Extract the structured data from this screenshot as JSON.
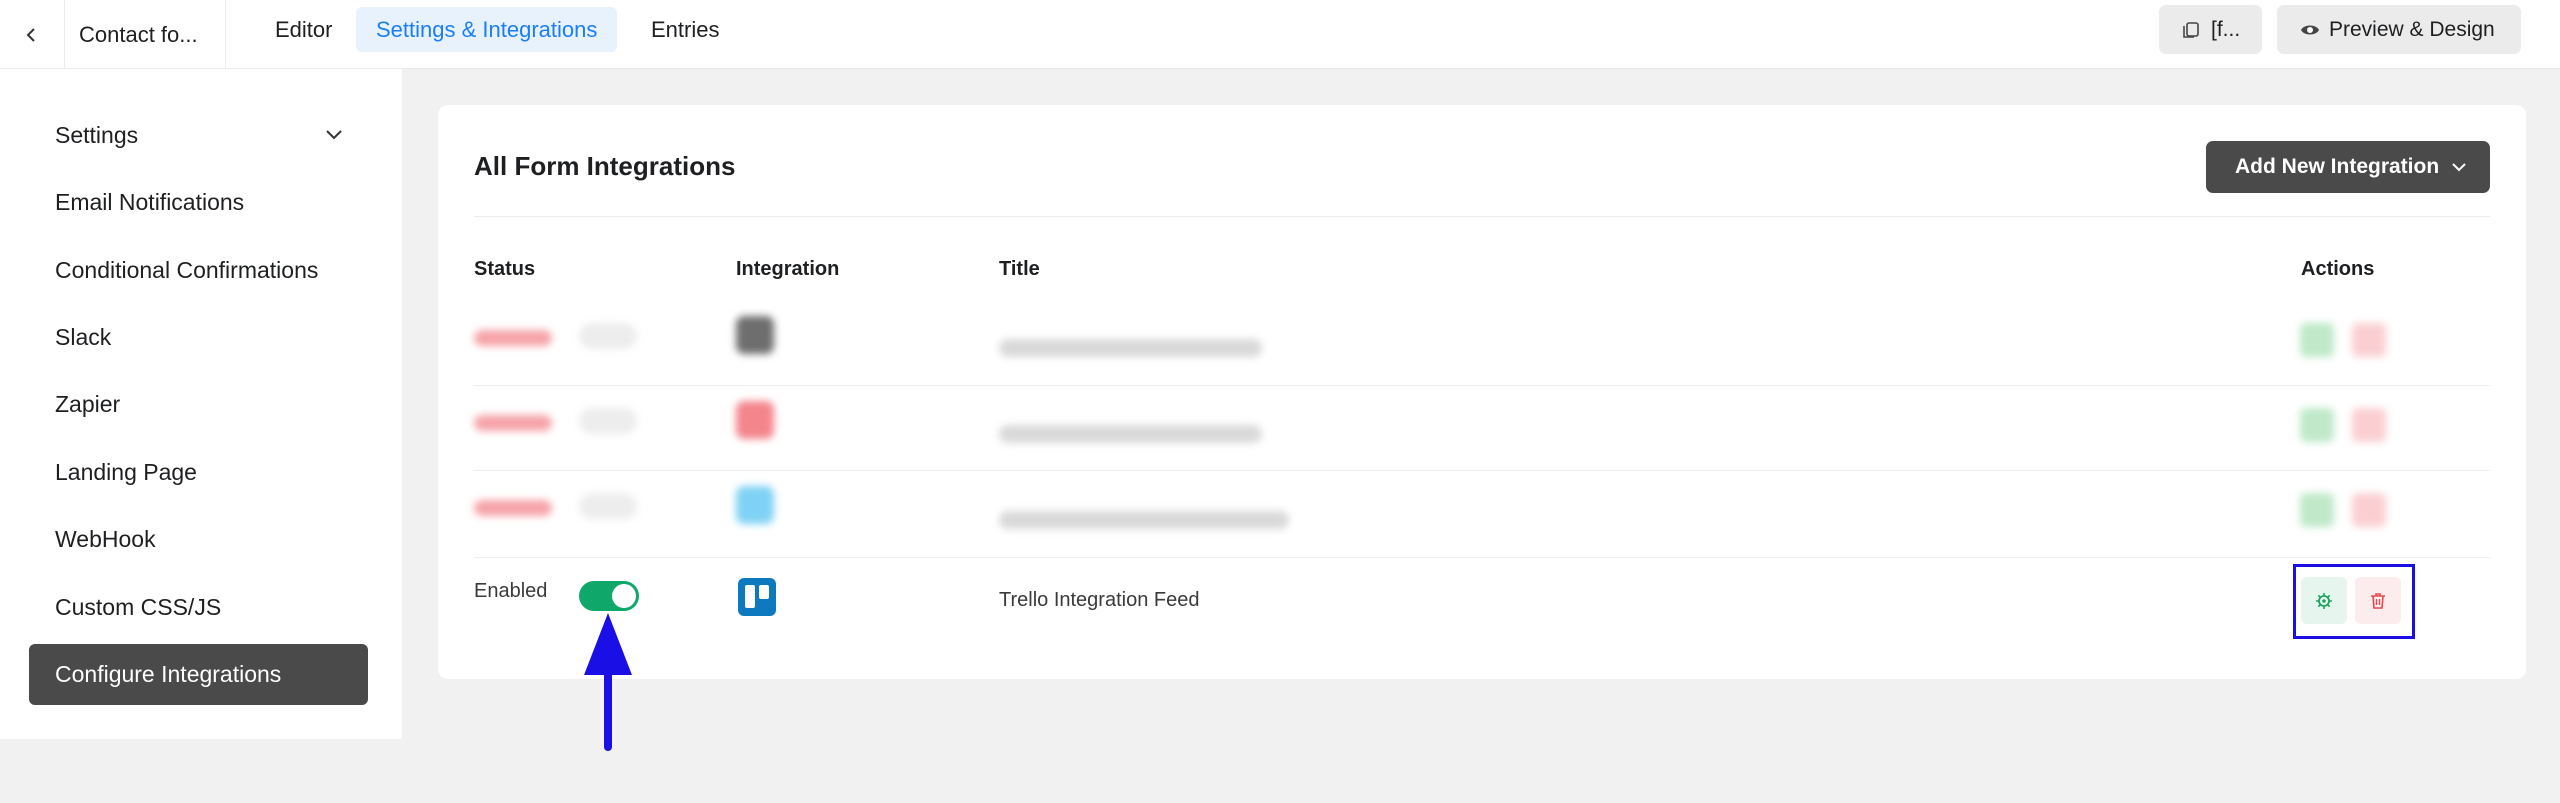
{
  "header": {
    "back_icon": "chevron-left-icon",
    "form_name": "Contact fo...",
    "tabs": [
      {
        "label": "Editor"
      },
      {
        "label": "Settings & Integrations",
        "active": true
      },
      {
        "label": "Entries"
      }
    ],
    "shortcode_label": "[f...",
    "preview_label": "Preview & Design"
  },
  "sidebar": {
    "items": [
      {
        "label": "Settings"
      },
      {
        "label": "Email Notifications"
      },
      {
        "label": "Conditional Confirmations"
      },
      {
        "label": "Slack"
      },
      {
        "label": "Zapier"
      },
      {
        "label": "Landing Page"
      },
      {
        "label": "WebHook"
      },
      {
        "label": "Custom CSS/JS"
      },
      {
        "label": "Configure Integrations",
        "active": true
      }
    ]
  },
  "main": {
    "title": "All Form Integrations",
    "add_button": "Add New Integration",
    "columns": [
      "Status",
      "Integration",
      "Title",
      "Actions"
    ],
    "rows": [
      {
        "status": "Enabled",
        "enabled": true,
        "integration_icon": "trello-icon",
        "title": "Trello Integration Feed"
      }
    ]
  },
  "colors": {
    "accent": "#1a7efb",
    "toggle_on": "#0fa76a",
    "dark_button": "#4a4a4a",
    "annotation": "#1a10e6"
  }
}
